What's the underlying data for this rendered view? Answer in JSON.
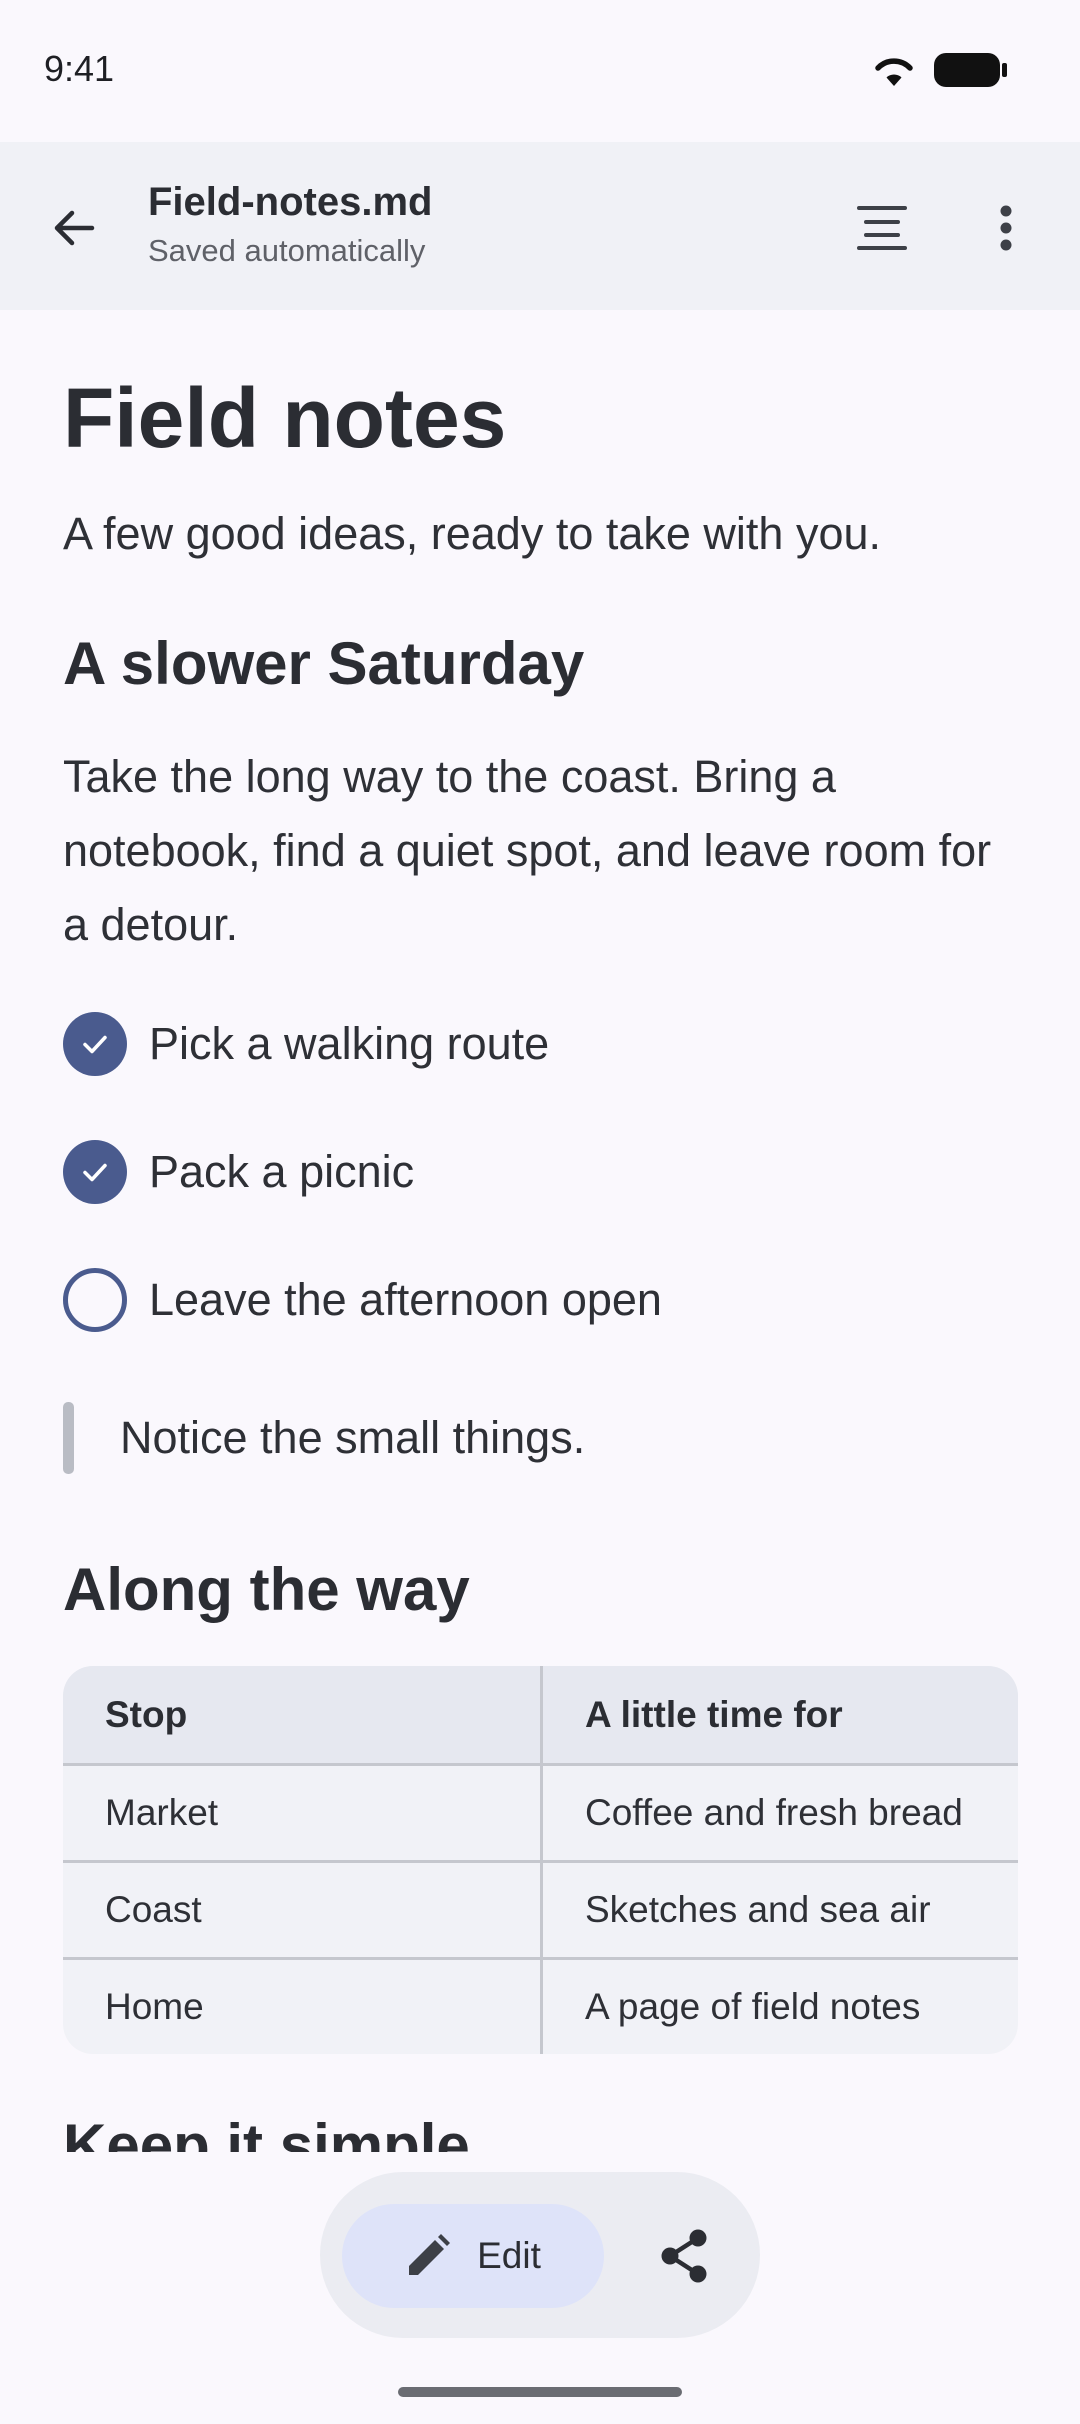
{
  "status_bar": {
    "time": "9:41",
    "wifi_icon": "wifi-icon",
    "battery_icon": "battery-icon"
  },
  "app_bar": {
    "back_icon": "arrow-back-icon",
    "file_name": "Field-notes.md",
    "save_status": "Saved automatically",
    "outline_icon": "outline-icon",
    "more_icon": "more-vert-icon"
  },
  "document": {
    "title": "Field notes",
    "intro": "A few good ideas, ready to take with you.",
    "section1": {
      "heading": "A slower Saturday",
      "paragraph": "Take the long way to the coast. Bring a notebook, find a quiet spot, and leave room for a detour."
    },
    "tasks": [
      {
        "label": "Pick a walking route",
        "checked": true
      },
      {
        "label": "Pack a picnic",
        "checked": true
      },
      {
        "label": "Leave the afternoon open",
        "checked": false
      }
    ],
    "quote": "Notice the small things.",
    "section2": {
      "heading": "Along the way"
    },
    "table": {
      "headers": [
        "Stop",
        "A little time for"
      ],
      "rows": [
        [
          "Market",
          "Coffee and fresh bread"
        ],
        [
          "Coast",
          "Sketches and sea air"
        ],
        [
          "Home",
          "A page of field notes"
        ]
      ]
    },
    "section3": {
      "heading": "Keep it simple"
    }
  },
  "toolbar": {
    "edit_label": "Edit",
    "edit_icon": "pencil-icon",
    "share_icon": "share-icon"
  },
  "colors": {
    "background": "#faf8fd",
    "app_bar": "#f0f1f6",
    "accent": "#4a5b8e",
    "edit_button": "#dee3f9"
  }
}
